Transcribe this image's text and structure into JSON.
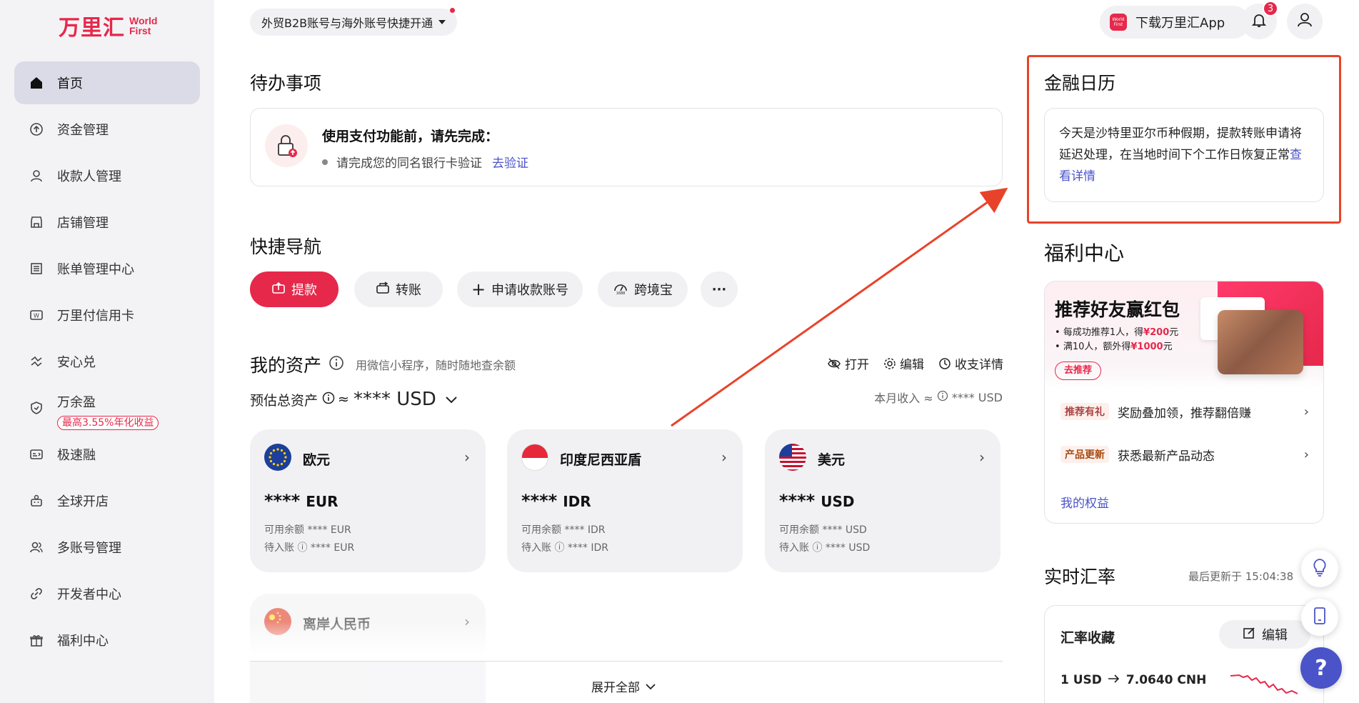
{
  "brand": {
    "logo_cn": "万里汇",
    "logo_en_1": "World",
    "logo_en_2": "First"
  },
  "sidebar": {
    "items": [
      {
        "label": "首页"
      },
      {
        "label": "资金管理"
      },
      {
        "label": "收款人管理"
      },
      {
        "label": "店铺管理"
      },
      {
        "label": "账单管理中心"
      },
      {
        "label": "万里付信用卡"
      },
      {
        "label": "安心兑"
      },
      {
        "label": "万余盈",
        "badge": "最高3.55%年化收益"
      },
      {
        "label": "极速融"
      },
      {
        "label": "全球开店"
      },
      {
        "label": "多账号管理"
      },
      {
        "label": "开发者中心"
      },
      {
        "label": "福利中心"
      }
    ]
  },
  "topbar": {
    "account_switch": "外贸B2B账号与海外账号快捷开通",
    "app_download": "下载万里汇App",
    "app_icon_text": "World First",
    "notification_count": "3"
  },
  "todo": {
    "title": "待办事项",
    "card_title": "使用支付功能前，请先完成：",
    "item_text": "请完成您的同名银行卡验证",
    "item_link": "去验证"
  },
  "quicknav": {
    "title": "快捷导航",
    "buttons": [
      "提款",
      "转账",
      "申请收款账号",
      "跨境宝"
    ],
    "more": "···"
  },
  "assets": {
    "title": "我的资产",
    "subtitle": "用微信小程序，随时随地查余额",
    "tools": [
      "打开",
      "编辑",
      "收支详情"
    ],
    "est_label": "预估总资产",
    "est_approx": "≈",
    "est_value": "**** USD",
    "income_label": "本月收入 ≈",
    "income_value": "**** USD",
    "cards": [
      {
        "name": "欧元",
        "stars": "****",
        "code": "EUR",
        "available": "可用余额 **** EUR",
        "pending_label": "待入账",
        "pending": "**** EUR"
      },
      {
        "name": "印度尼西亚盾",
        "stars": "****",
        "code": "IDR",
        "available": "可用余额 **** IDR",
        "pending_label": "待入账",
        "pending": "**** IDR"
      },
      {
        "name": "美元",
        "stars": "****",
        "code": "USD",
        "available": "可用余额 **** USD",
        "pending_label": "待入账",
        "pending": "**** USD"
      },
      {
        "name": "离岸人民币"
      }
    ],
    "expand": "展开全部"
  },
  "calendar": {
    "title": "金融日历",
    "text": "今天是沙特里亚尔币种假期，提款转账申请将延迟处理，在当地时间下个工作日恢复正常",
    "link": "查看详情"
  },
  "welfare": {
    "title": "福利中心",
    "banner_title": "推荐好友赢红包",
    "banner_line1_pre": "每成功推荐1人，得",
    "banner_line1_val": "¥200",
    "banner_line1_post": "元",
    "banner_line2_pre": "满10人，额外得",
    "banner_line2_val": "¥1000",
    "banner_line2_post": "元",
    "banner_button": "去推荐",
    "rows": [
      {
        "tag": "推荐有礼",
        "text": "奖励叠加领，推荐翻倍赚"
      },
      {
        "tag": "产品更新",
        "text": "获悉最新产品动态"
      }
    ],
    "link": "我的权益"
  },
  "rates": {
    "title": "实时汇率",
    "updated": "最后更新于 15:04:38",
    "card_title": "汇率收藏",
    "edit": "编辑",
    "pair_from": "1 USD",
    "pair_to": "7.0640 CNH"
  },
  "help": {
    "label": "?"
  },
  "colors": {
    "brand": "#e6284b",
    "link": "#4a53c8",
    "highlight": "#e8432a"
  }
}
